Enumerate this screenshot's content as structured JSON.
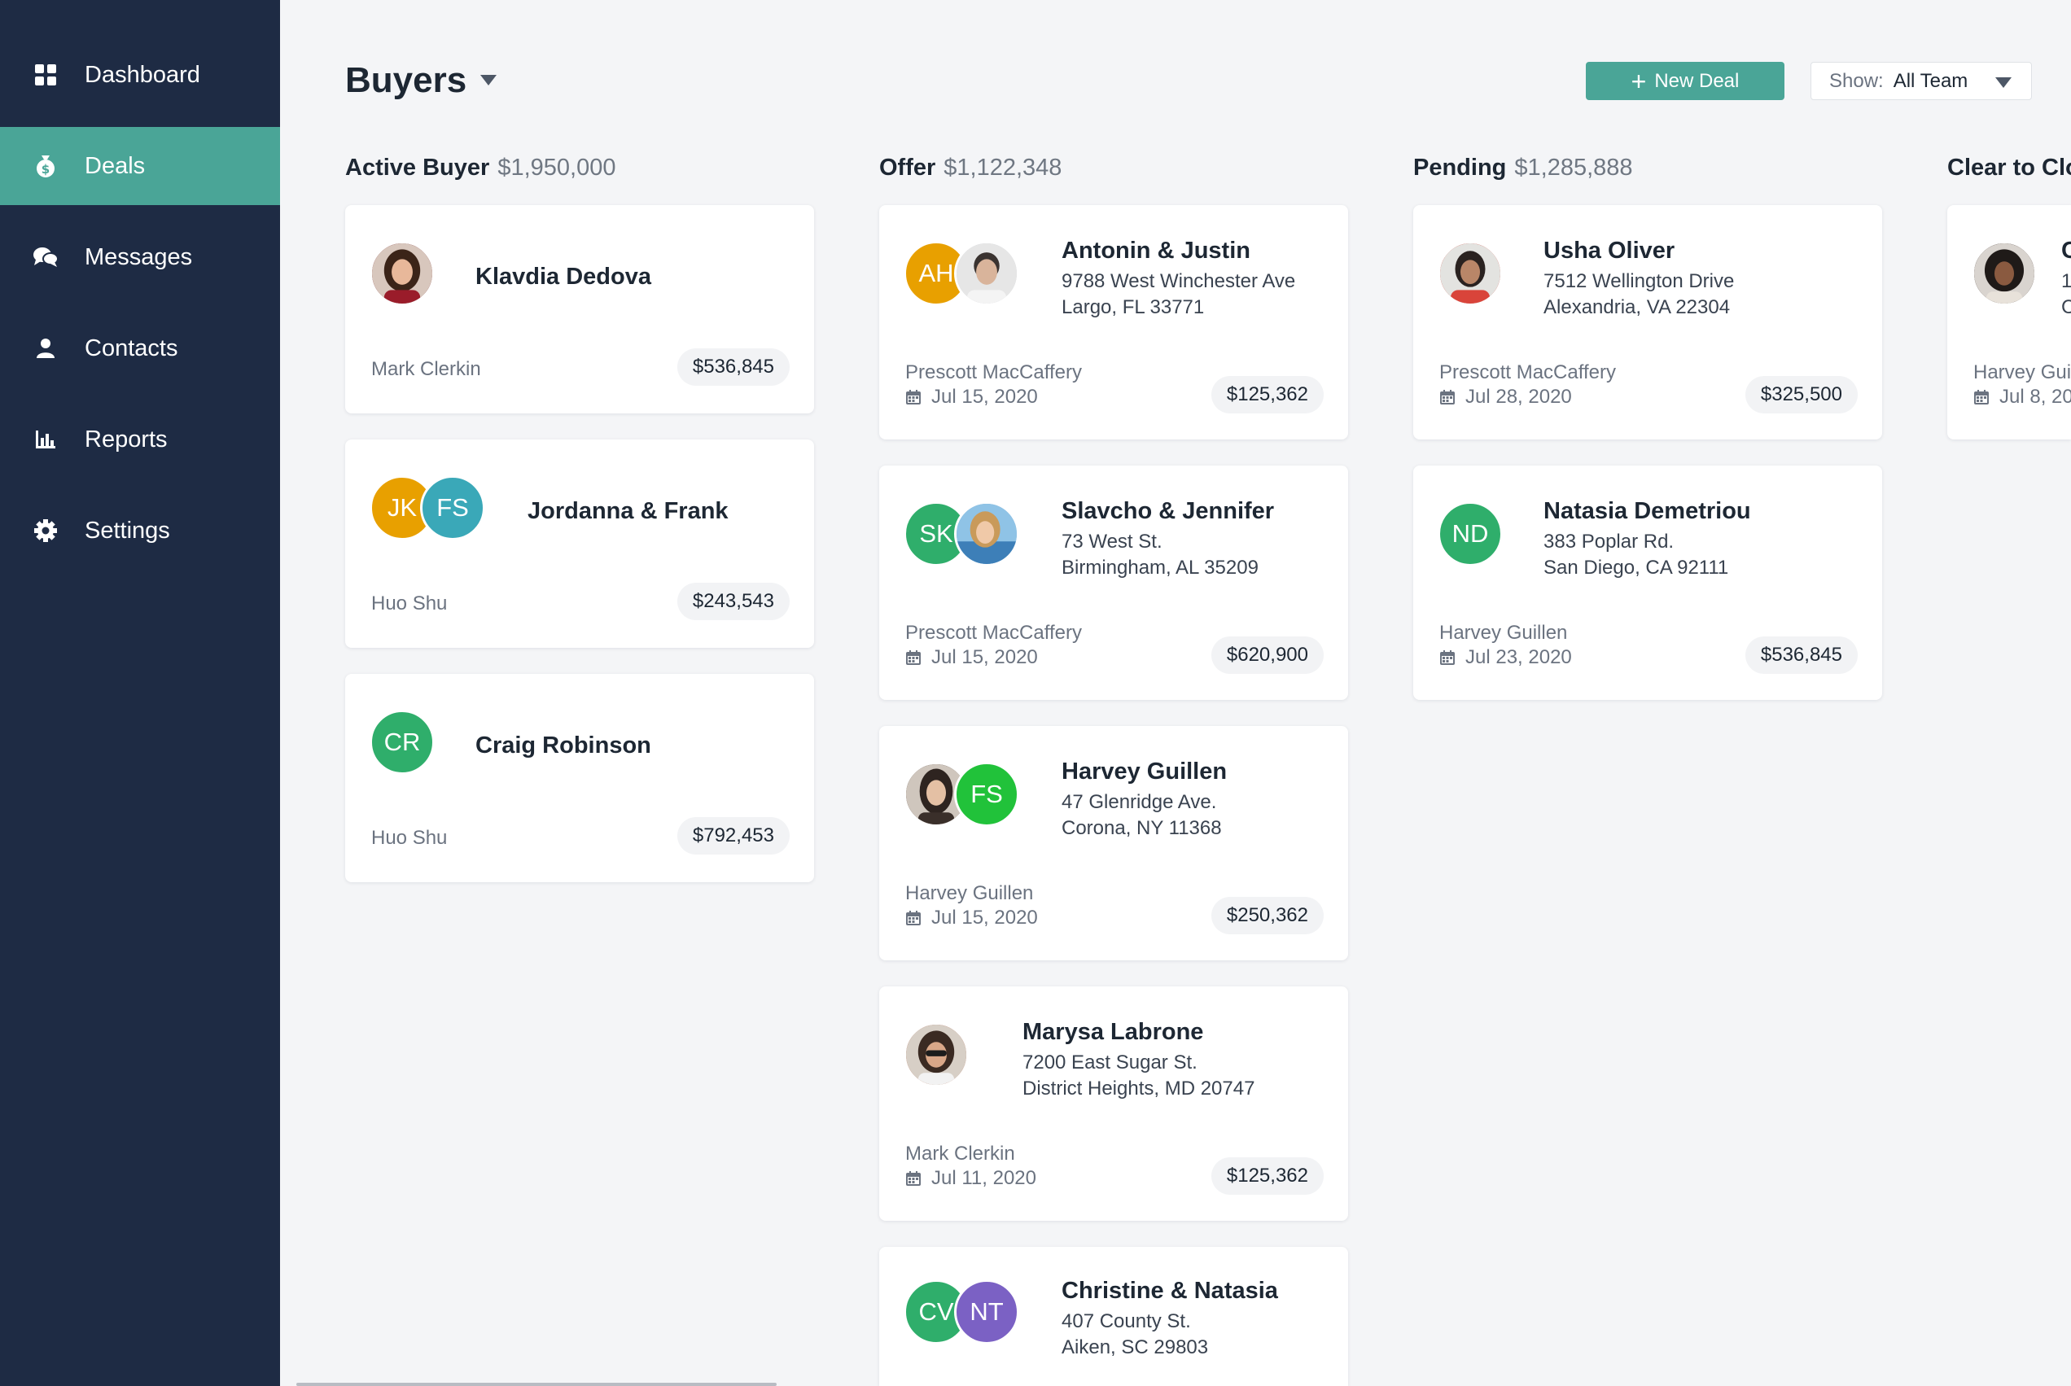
{
  "nav": {
    "items": [
      {
        "label": "Dashboard",
        "icon": "dashboard-grid-icon"
      },
      {
        "label": "Deals",
        "icon": "money-bag-icon",
        "active": true
      },
      {
        "label": "Messages",
        "icon": "chat-bubbles-icon"
      },
      {
        "label": "Contacts",
        "icon": "person-icon"
      },
      {
        "label": "Reports",
        "icon": "bar-chart-icon"
      },
      {
        "label": "Settings",
        "icon": "gear-icon"
      }
    ]
  },
  "header": {
    "title": "Buyers",
    "new_deal_label": "New Deal",
    "show_label": "Show:",
    "show_value": "All Team"
  },
  "colors": {
    "sidebar": "#1e2b44",
    "accent": "#4aa597",
    "avatar_orange": "#e8a000",
    "avatar_teal": "#3aa8b8",
    "avatar_green": "#2fae6b",
    "avatar_bright_green": "#21c23a",
    "avatar_purple": "#7b61c4"
  },
  "columns": [
    {
      "name": "Active Buyer",
      "total": "$1,950,000",
      "cards": [
        {
          "name": "Klavdia Dedova",
          "agent": "Mark Clerkin",
          "amount": "$536,845"
        },
        {
          "name": "Jordanna & Frank",
          "initials": [
            "JK",
            "FS"
          ],
          "agent": "Huo Shu",
          "amount": "$243,543"
        },
        {
          "name": "Craig Robinson",
          "initials": [
            "CR"
          ],
          "agent": "Huo Shu",
          "amount": "$792,453"
        }
      ]
    },
    {
      "name": "Offer",
      "total": "$1,122,348",
      "cards": [
        {
          "name": "Antonin & Justin",
          "initials": [
            "AH"
          ],
          "addr1": "9788 West Winchester Ave",
          "addr2": "Largo, FL 33771",
          "agent": "Prescott MacCaffery",
          "date": "Jul 15, 2020",
          "amount": "$125,362"
        },
        {
          "name": "Slavcho & Jennifer",
          "initials": [
            "SK"
          ],
          "addr1": "73 West St.",
          "addr2": "Birmingham, AL 35209",
          "agent": "Prescott MacCaffery",
          "date": "Jul 15, 2020",
          "amount": "$620,900"
        },
        {
          "name": "Harvey Guillen",
          "initials": [
            "FS"
          ],
          "addr1": "47 Glenridge Ave.",
          "addr2": "Corona, NY 11368",
          "agent": "Harvey Guillen",
          "date": "Jul 15, 2020",
          "amount": "$250,362"
        },
        {
          "name": "Marysa Labrone",
          "addr1": "7200 East Sugar St.",
          "addr2": "District Heights, MD 20747",
          "agent": "Mark Clerkin",
          "date": "Jul 11, 2020",
          "amount": "$125,362"
        },
        {
          "name": "Christine & Natasia",
          "initials": [
            "CV",
            "NT"
          ],
          "addr1": "407 County St.",
          "addr2": "Aiken, SC 29803"
        }
      ]
    },
    {
      "name": "Pending",
      "total": "$1,285,888",
      "cards": [
        {
          "name": "Usha Oliver",
          "addr1": "7512 Wellington Drive",
          "addr2": "Alexandria, VA 22304",
          "agent": "Prescott MacCaffery",
          "date": "Jul 28, 2020",
          "amount": "$325,500"
        },
        {
          "name": "Natasia Demetriou",
          "initials": [
            "ND"
          ],
          "addr1": "383 Poplar Rd.",
          "addr2": "San Diego, CA 92111",
          "agent": "Harvey Guillen",
          "date": "Jul 23, 2020",
          "amount": "$536,845"
        }
      ]
    },
    {
      "name": "Clear to Clo",
      "cards": [
        {
          "name": "C",
          "addr1": "1",
          "addr2": "C",
          "agent": "Harvey Gui",
          "date": "Jul 8, 20"
        }
      ]
    }
  ]
}
